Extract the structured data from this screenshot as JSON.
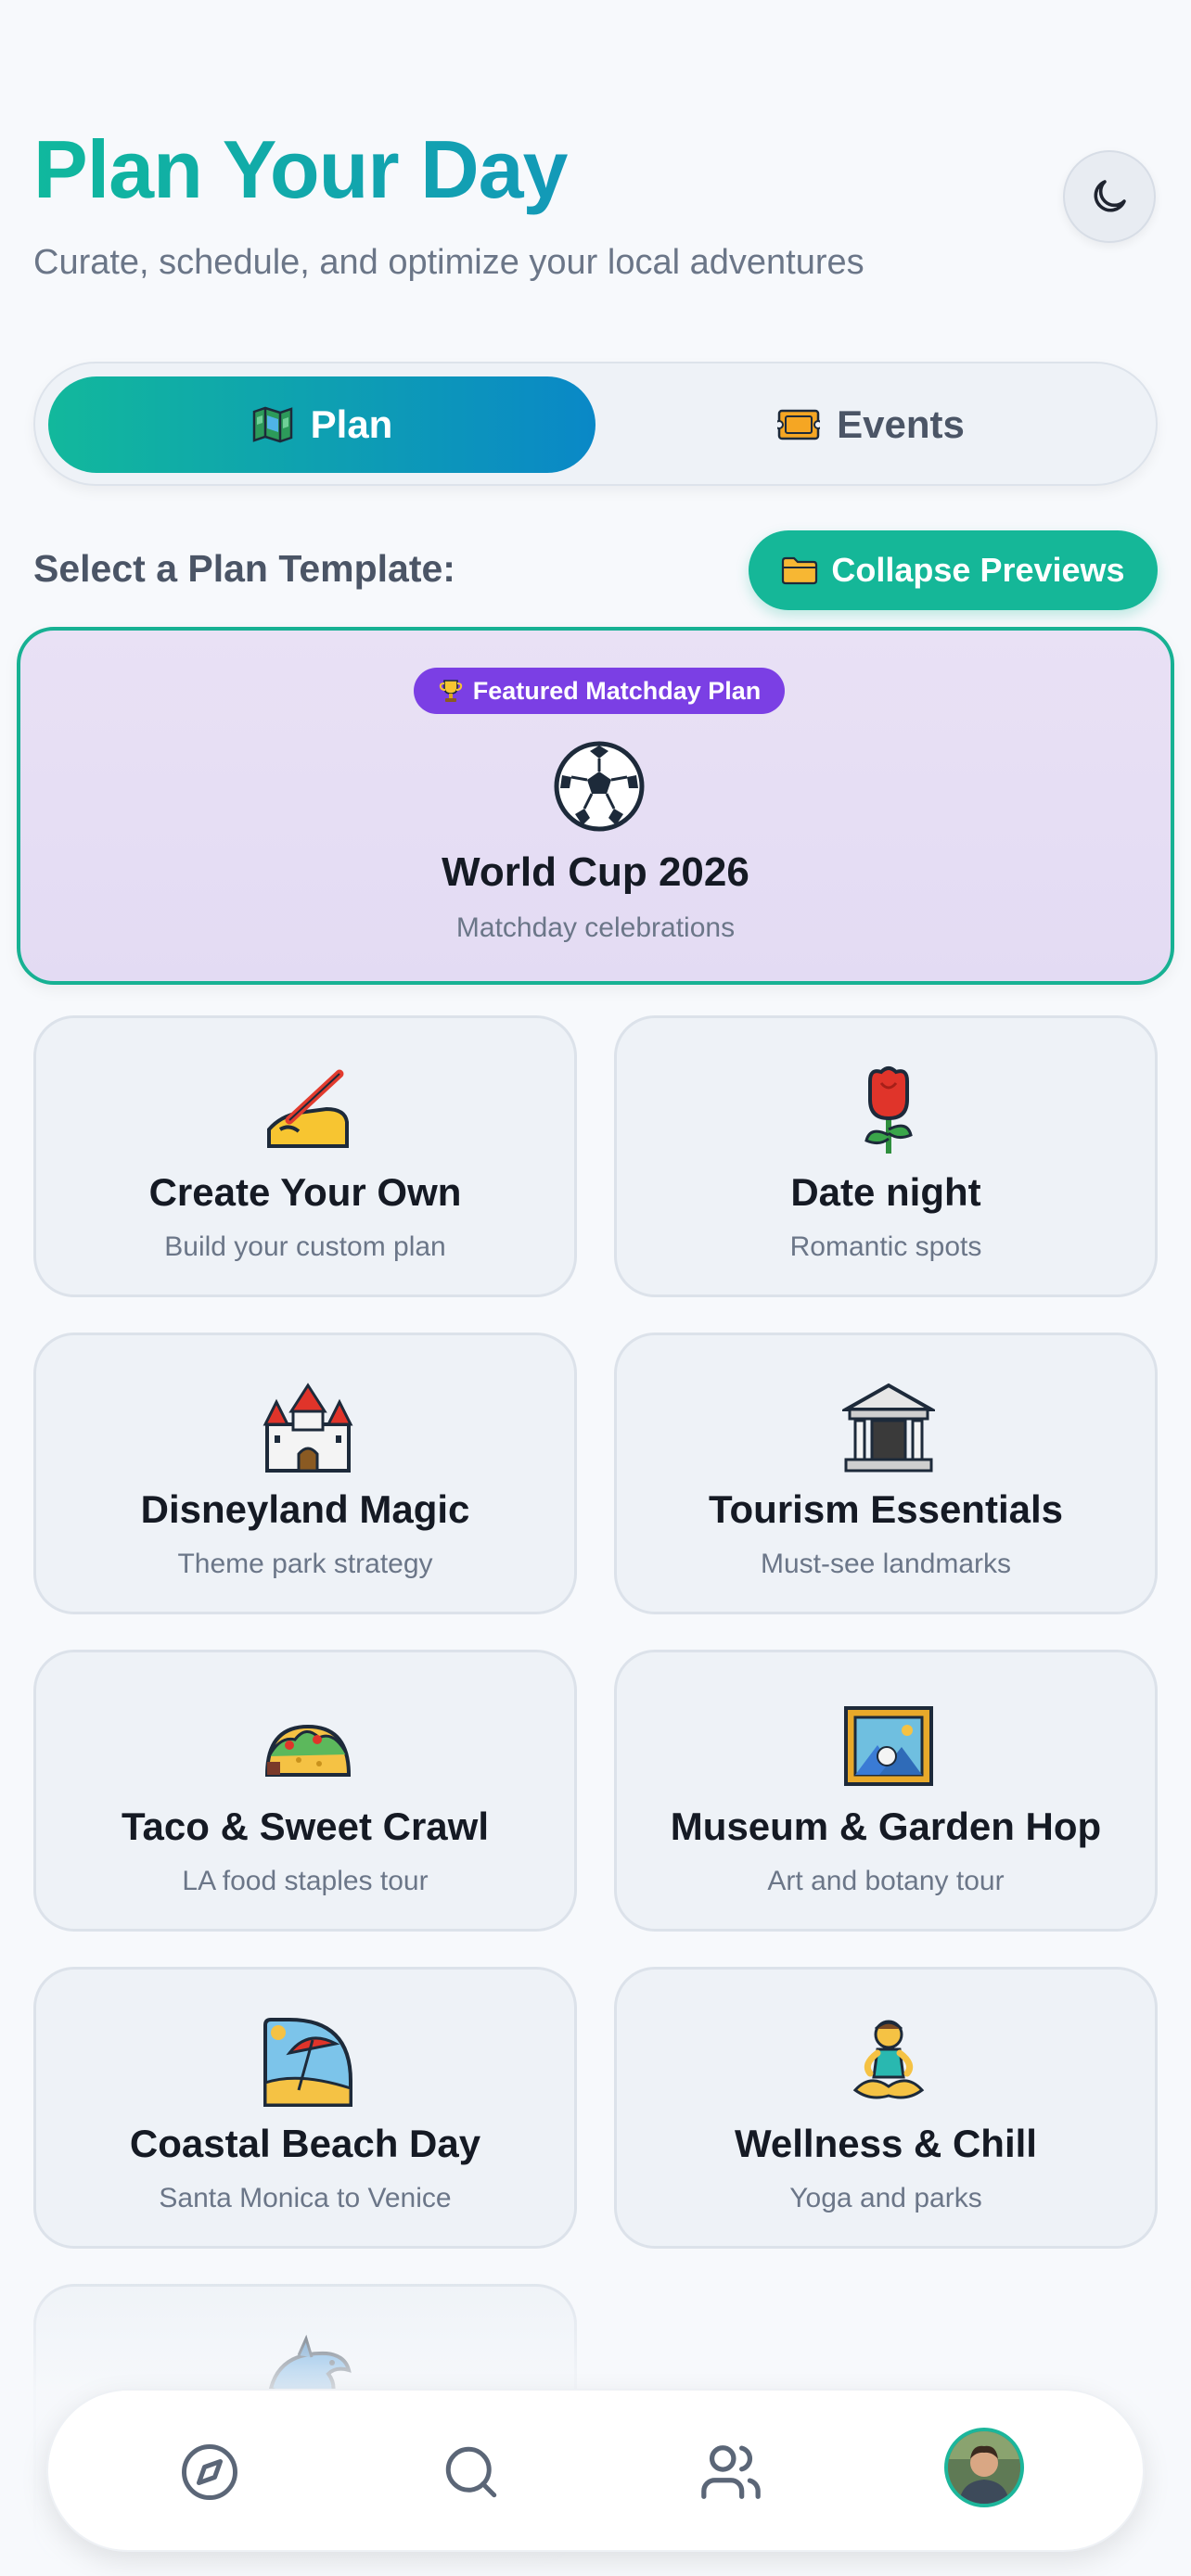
{
  "header": {
    "title": "Plan Your Day",
    "subtitle": "Curate, schedule, and optimize your local adventures",
    "theme_toggle_icon": "moon-icon"
  },
  "tabs": [
    {
      "label": "Plan",
      "icon": "map-icon",
      "active": true
    },
    {
      "label": "Events",
      "icon": "ticket-icon",
      "active": false
    }
  ],
  "section": {
    "label": "Select a Plan Template:",
    "collapse_button": "Collapse Previews",
    "collapse_icon": "folder-icon"
  },
  "featured": {
    "badge": "Featured Matchday Plan",
    "badge_icon": "trophy-icon",
    "icon": "soccer-ball-icon",
    "title": "World Cup 2026",
    "subtitle": "Matchday celebrations"
  },
  "templates": [
    {
      "title": "Create Your Own",
      "subtitle": "Build your custom plan",
      "icon": "writing-hand-icon"
    },
    {
      "title": "Date night",
      "subtitle": "Romantic spots",
      "icon": "rose-icon"
    },
    {
      "title": "Disneyland Magic",
      "subtitle": "Theme park strategy",
      "icon": "castle-icon"
    },
    {
      "title": "Tourism Essentials",
      "subtitle": "Must-see landmarks",
      "icon": "classical-building-icon"
    },
    {
      "title": "Taco & Sweet Crawl",
      "subtitle": "LA food staples tour",
      "icon": "taco-icon"
    },
    {
      "title": "Museum & Garden Hop",
      "subtitle": "Art and botany tour",
      "icon": "framed-picture-icon"
    },
    {
      "title": "Coastal Beach Day",
      "subtitle": "Santa Monica to Venice",
      "icon": "beach-umbrella-icon"
    },
    {
      "title": "Wellness & Chill",
      "subtitle": "Yoga and parks",
      "icon": "person-lotus-icon"
    },
    {
      "title": "",
      "subtitle": "",
      "icon": "dolphin-icon"
    }
  ],
  "bottom_nav": [
    {
      "name": "explore",
      "icon": "compass-icon"
    },
    {
      "name": "search",
      "icon": "search-icon"
    },
    {
      "name": "friends",
      "icon": "users-icon"
    },
    {
      "name": "profile",
      "icon": "avatar"
    }
  ],
  "colors": {
    "accent_teal": "#15b798",
    "accent_blue": "#0a88c7",
    "featured_border": "#17b193",
    "featured_badge": "#7b3fe4"
  }
}
